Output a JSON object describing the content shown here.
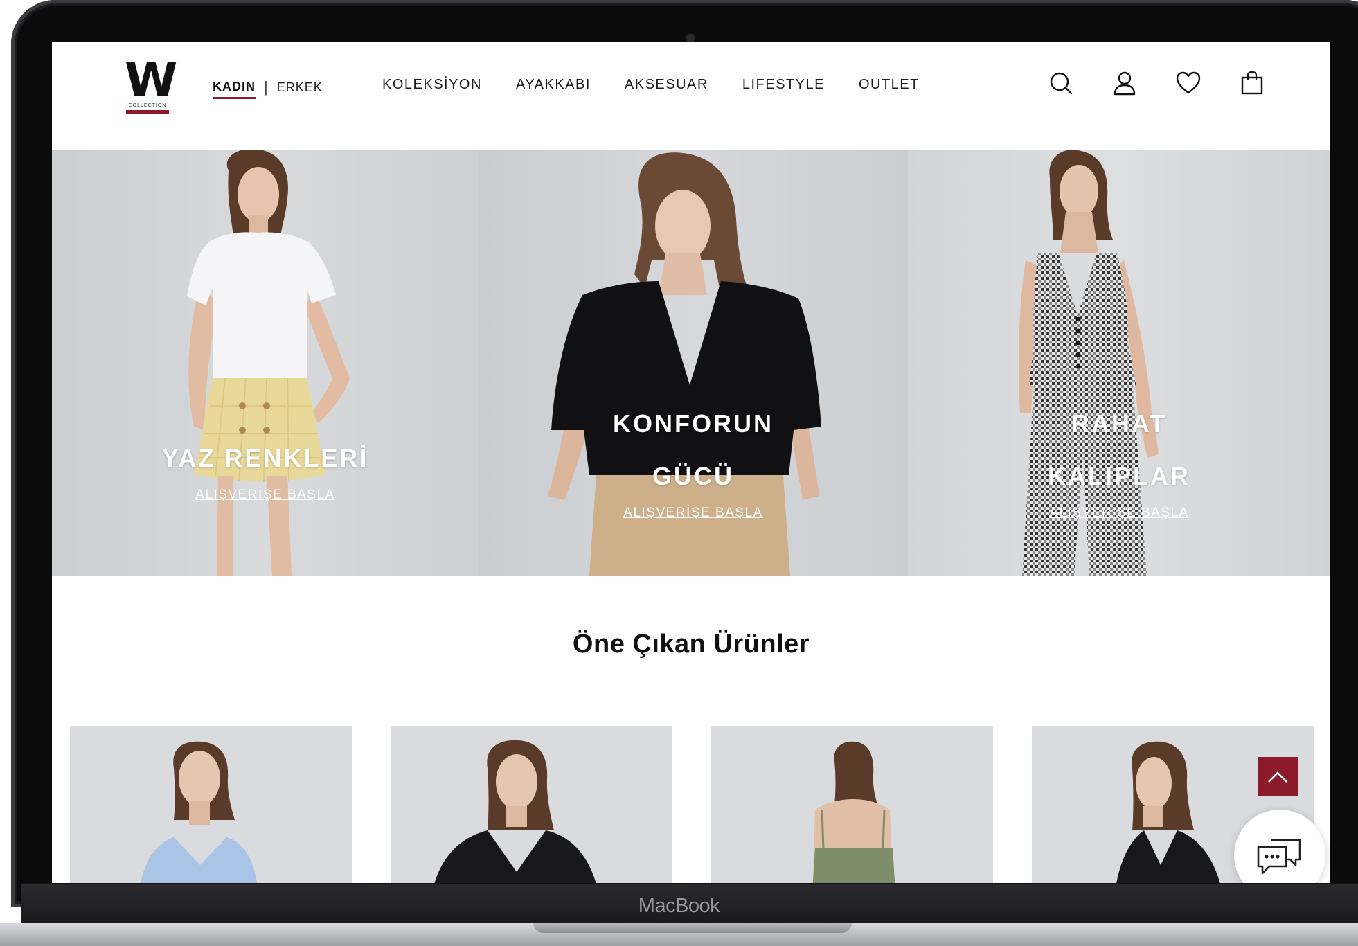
{
  "colors": {
    "brand": "#8b1a2b",
    "text": "#111111",
    "hero_text": "#ffffff"
  },
  "header": {
    "logo_letter": "W",
    "logo_subtext": "COLLECTION",
    "gender_active": "KADIN",
    "gender_separator": "|",
    "gender_inactive": "ERKEK",
    "nav": [
      {
        "label": "KOLEKSİYON"
      },
      {
        "label": "AYAKKABI"
      },
      {
        "label": "AKSESUAR"
      },
      {
        "label": "LIFESTYLE"
      },
      {
        "label": "OUTLET"
      }
    ],
    "icons": [
      "search-icon",
      "user-icon",
      "heart-icon",
      "shopping-bag-icon"
    ]
  },
  "hero": {
    "panels": [
      {
        "title_line1": "YAZ RENKLERİ",
        "title_line2": "",
        "cta": "ALIŞVERİŞE BAŞLA"
      },
      {
        "title_line1": "KONFORUN",
        "title_line2": "GÜCÜ",
        "cta": "ALIŞVERİŞE BAŞLA"
      },
      {
        "title_line1": "RAHAT",
        "title_line2": "KALIPLAR",
        "cta": "ALIŞVERİŞE BAŞLA"
      }
    ]
  },
  "featured": {
    "title": "Öne Çıkan Ürünler"
  },
  "widgets": {
    "scroll_top_icon": "chevron-up-icon",
    "chat_icon": "chat-bubbles-icon"
  },
  "device": {
    "brand": "MacBook"
  }
}
